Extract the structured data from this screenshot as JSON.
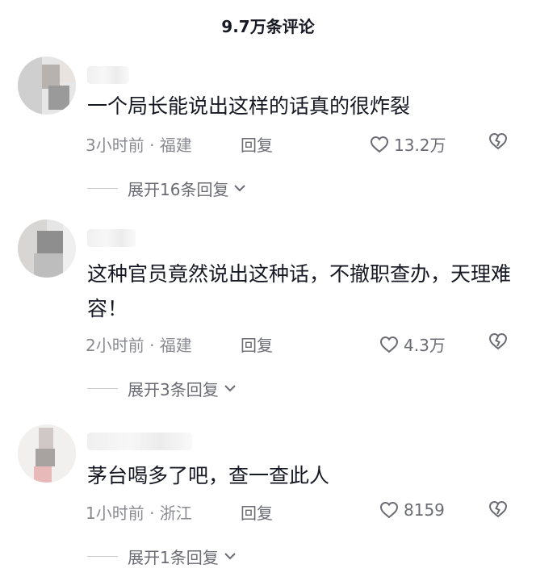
{
  "header": {
    "title": "9.7万条评论"
  },
  "comments": [
    {
      "text": "一个局长能说出这样的话真的很炸裂",
      "time_location": "3小时前 · 福建",
      "reply_label": "回复",
      "likes": "13.2万",
      "expand_label": "展开16条回复"
    },
    {
      "text": "这种官员竟然说出这种话，不撤职查办，天理难容！",
      "time_location": "2小时前 · 福建",
      "reply_label": "回复",
      "likes": "4.3万",
      "expand_label": "展开3条回复"
    },
    {
      "text": "茅台喝多了吧，查一查此人",
      "time_location": "1小时前 · 浙江",
      "reply_label": "回复",
      "likes": "8159",
      "expand_label": "展开1条回复"
    }
  ],
  "icons": {
    "like": "heart-outline-icon",
    "dislike": "broken-heart-icon",
    "expand": "chevron-down-icon"
  },
  "colors": {
    "text": "#161823",
    "secondary": "#8a8b91",
    "muted": "#6b6c73"
  }
}
